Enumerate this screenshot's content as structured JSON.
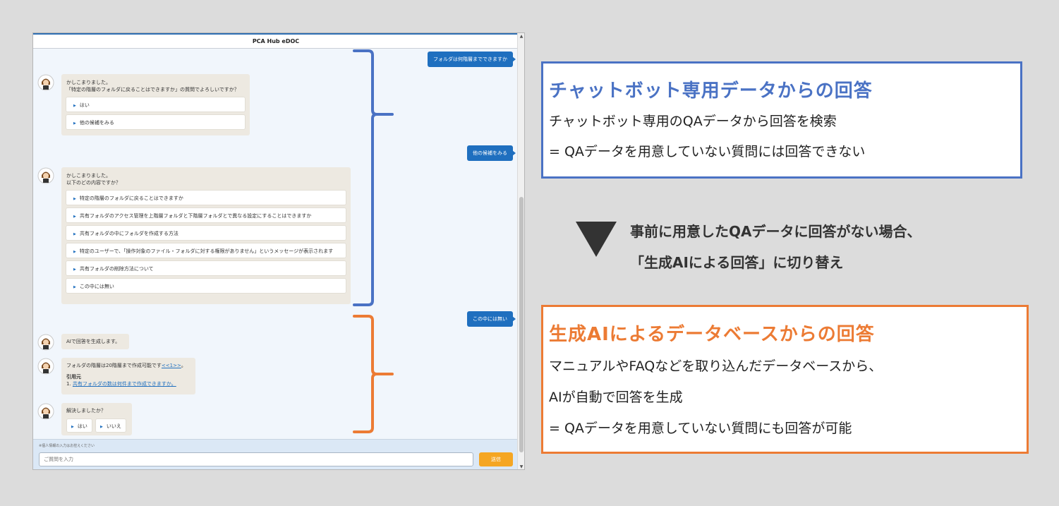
{
  "chat": {
    "title": "PCA Hub eDOC",
    "messages": {
      "user1": "フォルダは何階層までできますか",
      "bot1_line1": "かしこまりました。",
      "bot1_line2": "「特定の階層のフォルダに戻ることはできますか」の質問でよろしいですか？",
      "bot1_choices": [
        "はい",
        "他の候補をみる"
      ],
      "user2": "他の候補をみる",
      "bot2_line1": "かしこまりました。",
      "bot2_line2": "以下のどの内容ですか？",
      "bot2_choices": [
        "特定の階層のフォルダに戻ることはできますか",
        "共有フォルダのアクセス管理を上階層フォルダと下階層フォルダとで異なる設定にすることはできますか",
        "共有フォルダの中にフォルダを作成する方法",
        "特定のユーザーで、「操作対象のファイル・フォルダに対する権限がありません」というメッセージが表示されます",
        "共有フォルダの削除方法について",
        "この中には無い"
      ],
      "user3": "この中には無い",
      "bot3": "AIで回答を生成します。",
      "bot4_text": "フォルダの階層は20階層まで作成可能です",
      "bot4_link": "<<1>>",
      "bot4_period": "。",
      "bot4_source_label": "引用元",
      "bot4_source_num": "1.",
      "bot4_source_link": "共有フォルダの数は何件まで作成できますか。",
      "bot5": "解決しましたか？",
      "bot5_choices": [
        "はい",
        "いいえ"
      ]
    },
    "input_notice": "※個人情報の入力はお控えください",
    "input_placeholder": "ご質問を入力",
    "send_label": "送信"
  },
  "panels": {
    "blue": {
      "heading": "チャットボット専用データからの回答",
      "line1": "チャットボット専用のQAデータから回答を検索",
      "line2": " = QAデータを用意していない質問には回答できない",
      "color": "#4a72c4"
    },
    "transition": {
      "line1": "事前に用意したQAデータに回答がない場合、",
      "line2": "「生成AIによる回答」に切り替え"
    },
    "orange": {
      "heading": "生成AIによるデータベースからの回答",
      "line1": "マニュアルやFAQなどを取り込んだデータベースから、",
      "line2": "AIが自動で回答を生成",
      "line3": " = QAデータを用意していない質問にも回答が可能",
      "color": "#ec7b34"
    }
  }
}
